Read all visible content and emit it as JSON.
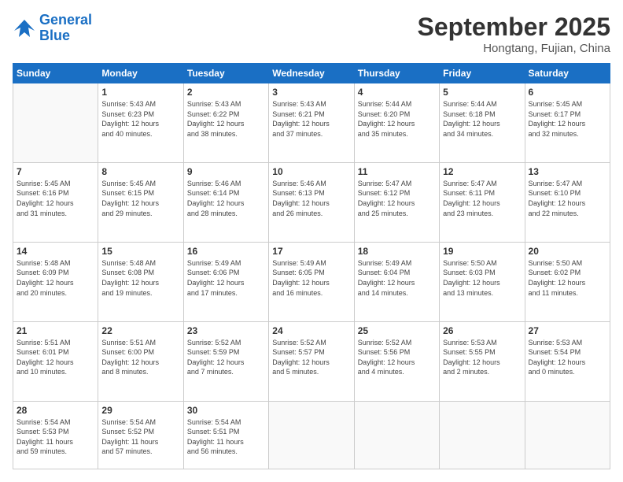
{
  "header": {
    "logo_line1": "General",
    "logo_line2": "Blue",
    "month": "September 2025",
    "location": "Hongtang, Fujian, China"
  },
  "weekdays": [
    "Sunday",
    "Monday",
    "Tuesday",
    "Wednesday",
    "Thursday",
    "Friday",
    "Saturday"
  ],
  "weeks": [
    [
      {
        "day": "",
        "info": ""
      },
      {
        "day": "1",
        "info": "Sunrise: 5:43 AM\nSunset: 6:23 PM\nDaylight: 12 hours\nand 40 minutes."
      },
      {
        "day": "2",
        "info": "Sunrise: 5:43 AM\nSunset: 6:22 PM\nDaylight: 12 hours\nand 38 minutes."
      },
      {
        "day": "3",
        "info": "Sunrise: 5:43 AM\nSunset: 6:21 PM\nDaylight: 12 hours\nand 37 minutes."
      },
      {
        "day": "4",
        "info": "Sunrise: 5:44 AM\nSunset: 6:20 PM\nDaylight: 12 hours\nand 35 minutes."
      },
      {
        "day": "5",
        "info": "Sunrise: 5:44 AM\nSunset: 6:18 PM\nDaylight: 12 hours\nand 34 minutes."
      },
      {
        "day": "6",
        "info": "Sunrise: 5:45 AM\nSunset: 6:17 PM\nDaylight: 12 hours\nand 32 minutes."
      }
    ],
    [
      {
        "day": "7",
        "info": "Sunrise: 5:45 AM\nSunset: 6:16 PM\nDaylight: 12 hours\nand 31 minutes."
      },
      {
        "day": "8",
        "info": "Sunrise: 5:45 AM\nSunset: 6:15 PM\nDaylight: 12 hours\nand 29 minutes."
      },
      {
        "day": "9",
        "info": "Sunrise: 5:46 AM\nSunset: 6:14 PM\nDaylight: 12 hours\nand 28 minutes."
      },
      {
        "day": "10",
        "info": "Sunrise: 5:46 AM\nSunset: 6:13 PM\nDaylight: 12 hours\nand 26 minutes."
      },
      {
        "day": "11",
        "info": "Sunrise: 5:47 AM\nSunset: 6:12 PM\nDaylight: 12 hours\nand 25 minutes."
      },
      {
        "day": "12",
        "info": "Sunrise: 5:47 AM\nSunset: 6:11 PM\nDaylight: 12 hours\nand 23 minutes."
      },
      {
        "day": "13",
        "info": "Sunrise: 5:47 AM\nSunset: 6:10 PM\nDaylight: 12 hours\nand 22 minutes."
      }
    ],
    [
      {
        "day": "14",
        "info": "Sunrise: 5:48 AM\nSunset: 6:09 PM\nDaylight: 12 hours\nand 20 minutes."
      },
      {
        "day": "15",
        "info": "Sunrise: 5:48 AM\nSunset: 6:08 PM\nDaylight: 12 hours\nand 19 minutes."
      },
      {
        "day": "16",
        "info": "Sunrise: 5:49 AM\nSunset: 6:06 PM\nDaylight: 12 hours\nand 17 minutes."
      },
      {
        "day": "17",
        "info": "Sunrise: 5:49 AM\nSunset: 6:05 PM\nDaylight: 12 hours\nand 16 minutes."
      },
      {
        "day": "18",
        "info": "Sunrise: 5:49 AM\nSunset: 6:04 PM\nDaylight: 12 hours\nand 14 minutes."
      },
      {
        "day": "19",
        "info": "Sunrise: 5:50 AM\nSunset: 6:03 PM\nDaylight: 12 hours\nand 13 minutes."
      },
      {
        "day": "20",
        "info": "Sunrise: 5:50 AM\nSunset: 6:02 PM\nDaylight: 12 hours\nand 11 minutes."
      }
    ],
    [
      {
        "day": "21",
        "info": "Sunrise: 5:51 AM\nSunset: 6:01 PM\nDaylight: 12 hours\nand 10 minutes."
      },
      {
        "day": "22",
        "info": "Sunrise: 5:51 AM\nSunset: 6:00 PM\nDaylight: 12 hours\nand 8 minutes."
      },
      {
        "day": "23",
        "info": "Sunrise: 5:52 AM\nSunset: 5:59 PM\nDaylight: 12 hours\nand 7 minutes."
      },
      {
        "day": "24",
        "info": "Sunrise: 5:52 AM\nSunset: 5:57 PM\nDaylight: 12 hours\nand 5 minutes."
      },
      {
        "day": "25",
        "info": "Sunrise: 5:52 AM\nSunset: 5:56 PM\nDaylight: 12 hours\nand 4 minutes."
      },
      {
        "day": "26",
        "info": "Sunrise: 5:53 AM\nSunset: 5:55 PM\nDaylight: 12 hours\nand 2 minutes."
      },
      {
        "day": "27",
        "info": "Sunrise: 5:53 AM\nSunset: 5:54 PM\nDaylight: 12 hours\nand 0 minutes."
      }
    ],
    [
      {
        "day": "28",
        "info": "Sunrise: 5:54 AM\nSunset: 5:53 PM\nDaylight: 11 hours\nand 59 minutes."
      },
      {
        "day": "29",
        "info": "Sunrise: 5:54 AM\nSunset: 5:52 PM\nDaylight: 11 hours\nand 57 minutes."
      },
      {
        "day": "30",
        "info": "Sunrise: 5:54 AM\nSunset: 5:51 PM\nDaylight: 11 hours\nand 56 minutes."
      },
      {
        "day": "",
        "info": ""
      },
      {
        "day": "",
        "info": ""
      },
      {
        "day": "",
        "info": ""
      },
      {
        "day": "",
        "info": ""
      }
    ]
  ]
}
